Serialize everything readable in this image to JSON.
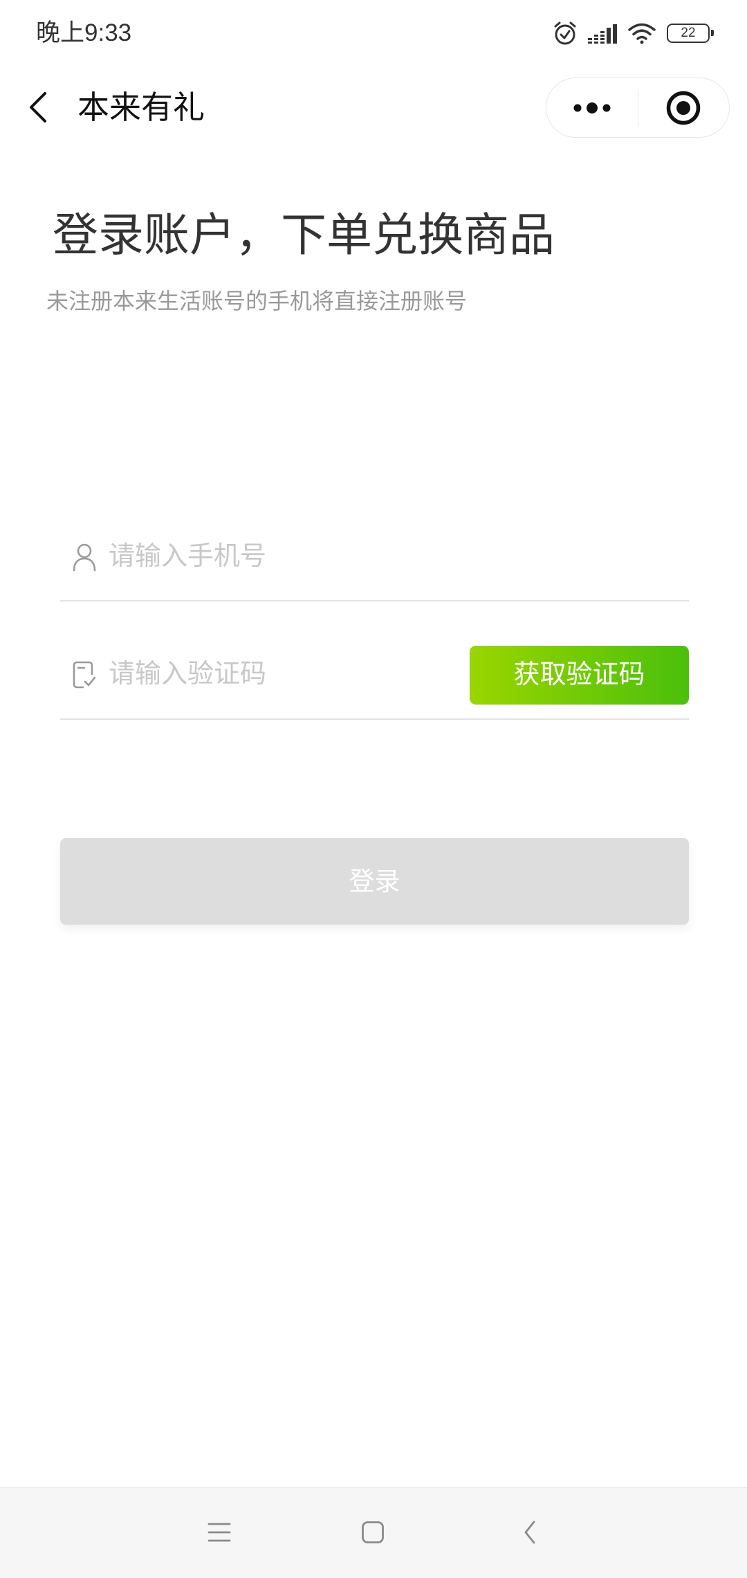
{
  "status_bar": {
    "time": "晚上9:33",
    "battery_level": "22",
    "icons": {
      "alarm": "alarm-clock-icon",
      "signal": "signal-icon",
      "wifi": "wifi-icon",
      "battery": "battery-icon"
    }
  },
  "nav_bar": {
    "title": "本来有礼",
    "back_icon": "chevron-left-icon",
    "capsule": {
      "more_icon": "more-dots-icon",
      "exit_icon": "target-circle-icon"
    }
  },
  "login": {
    "heading": "登录账户，下单兑换商品",
    "subtitle": "未注册本来生活账号的手机将直接注册账号",
    "phone_field": {
      "icon": "user-icon",
      "placeholder": "请输入手机号",
      "value": ""
    },
    "code_field": {
      "icon": "verify-code-icon",
      "placeholder": "请输入验证码",
      "value": ""
    },
    "get_code_button": "获取验证码",
    "submit_button": "登录"
  },
  "system_nav": {
    "icons": {
      "recents": "menu-lines-icon",
      "home": "home-square-icon",
      "back": "back-chevron-icon"
    }
  },
  "colors": {
    "text_primary": "#333333",
    "text_title": "#111111",
    "text_secondary": "#999999",
    "placeholder": "#c8c8c8",
    "icon_muted": "#9a9a9a",
    "divider": "#e3e3e3",
    "accent_start": "#9ad500",
    "accent_end": "#4bbf0d",
    "button_disabled": "#dddddd",
    "system_nav_bg": "#f6f6f6",
    "system_nav_icon": "#8a8a8a"
  }
}
